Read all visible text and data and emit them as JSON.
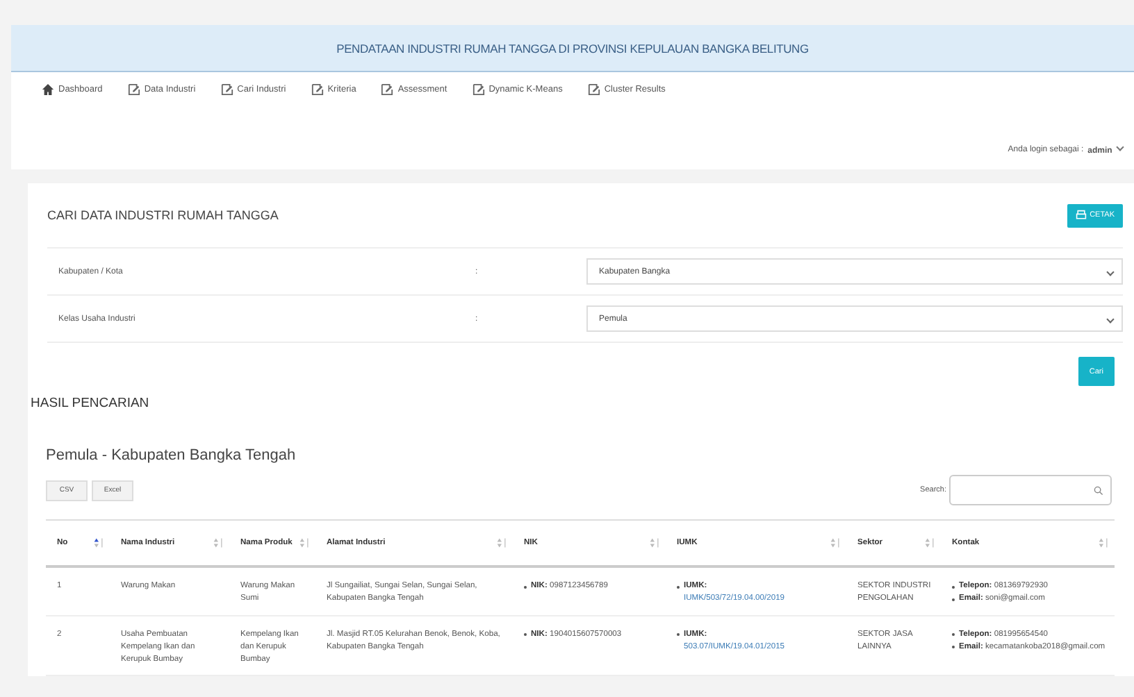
{
  "header": {
    "title": "PENDATAAN INDUSTRI RUMAH TANGGA DI PROVINSI KEPULAUAN BANGKA BELITUNG"
  },
  "nav": [
    {
      "label": "Dashboard",
      "kind": "home"
    },
    {
      "label": "Data Industri",
      "kind": "page"
    },
    {
      "label": "Cari Industri",
      "kind": "page"
    },
    {
      "label": "Kriteria",
      "kind": "page"
    },
    {
      "label": "Assessment",
      "kind": "page"
    },
    {
      "label": "Dynamic K-Means",
      "kind": "page"
    },
    {
      "label": "Cluster Results",
      "kind": "page"
    }
  ],
  "user": {
    "prefix": "Anda login sebagai :",
    "name": "admin"
  },
  "search_card": {
    "title": "CARI DATA INDUSTRI RUMAH TANGGA",
    "print_button": "CETAK",
    "fields": [
      {
        "label": "Kabupaten / Kota",
        "separator": ":",
        "value": "Kabupaten Bangka"
      },
      {
        "label": "Kelas Usaha Industri",
        "separator": ":",
        "value": "Pemula"
      }
    ],
    "search_button": "Cari"
  },
  "results": {
    "heading": "HASIL PENCARIAN",
    "subtitle": "Pemula - Kabupaten Bangka Tengah",
    "export_buttons": [
      "CSV",
      "Excel"
    ],
    "search_label": "Search:",
    "columns": [
      {
        "label": "No",
        "sorted": true
      },
      {
        "label": "Nama Industri",
        "sorted": false
      },
      {
        "label": "Nama Produk",
        "sorted": false
      },
      {
        "label": "Alamat Industri",
        "sorted": false
      },
      {
        "label": "NIK",
        "sorted": false
      },
      {
        "label": "IUMK",
        "sorted": false
      },
      {
        "label": "Sektor",
        "sorted": false
      },
      {
        "label": "Kontak",
        "sorted": false
      }
    ],
    "rows": [
      {
        "no": "1",
        "industri": "Warung Makan",
        "produk": "Warung Makan Sumi",
        "alamat": "Jl Sungailiat, Sungai Selan, Sungai Selan, Kabupaten Bangka Tengah",
        "nik": "**NIK:** 0987123456789",
        "iumk_label": "IUMK:",
        "iumk": "IUMK/503/72/19.04.00/2019",
        "sektor": "SEKTOR INDUSTRI PENGOLAHAN",
        "kontak": [
          "**Telepon:** 081369792930",
          "**Email:** soni@gmail.com"
        ]
      },
      {
        "no": "2",
        "industri": "Usaha Pembuatan Kempelang Ikan dan Kerupuk Bumbay",
        "produk": "Kempelang Ikan dan Kerupuk Bumbay",
        "alamat": "Jl. Masjid RT.05 Kelurahan Benok, Benok, Koba, Kabupaten Bangka Tengah",
        "nik": "**NIK:** 1904015607570003",
        "iumk_label": "IUMK:",
        "iumk": "503.07/IUMK/19.04.01/2015",
        "sektor": "SEKTOR JASA LAINNYA",
        "kontak": [
          "**Telepon:** 081995654540",
          "**Email:** kecamatankoba2018@gmail.com"
        ]
      }
    ]
  }
}
